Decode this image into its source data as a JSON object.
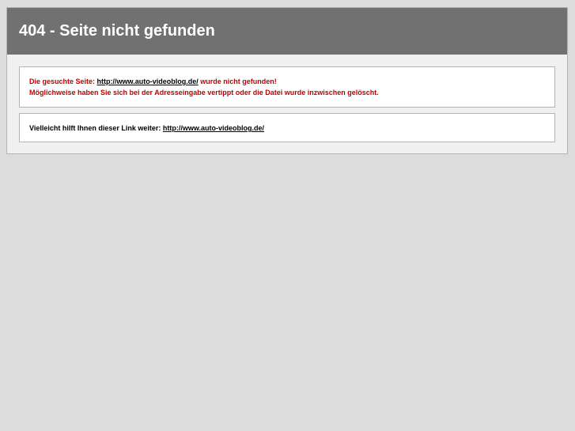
{
  "header": {
    "title": "404 - Seite nicht gefunden"
  },
  "error_box": {
    "prefix": "Die gesuchte Seite:",
    "url": "http://www.auto-videoblog.de/",
    "suffix": "wurde nicht gefunden!",
    "line2": "Möglichweise haben Sie sich bei der Adresseingabe vertippt oder die Datei wurde inzwischen gelöscht."
  },
  "hint_box": {
    "prefix": "Vielleicht hilft Ihnen dieser Link weiter:",
    "url": "http://www.auto-videoblog.de/"
  },
  "colors": {
    "header_bg": "#717171",
    "error_text": "#c00000",
    "page_bg": "#dcdcdc"
  }
}
